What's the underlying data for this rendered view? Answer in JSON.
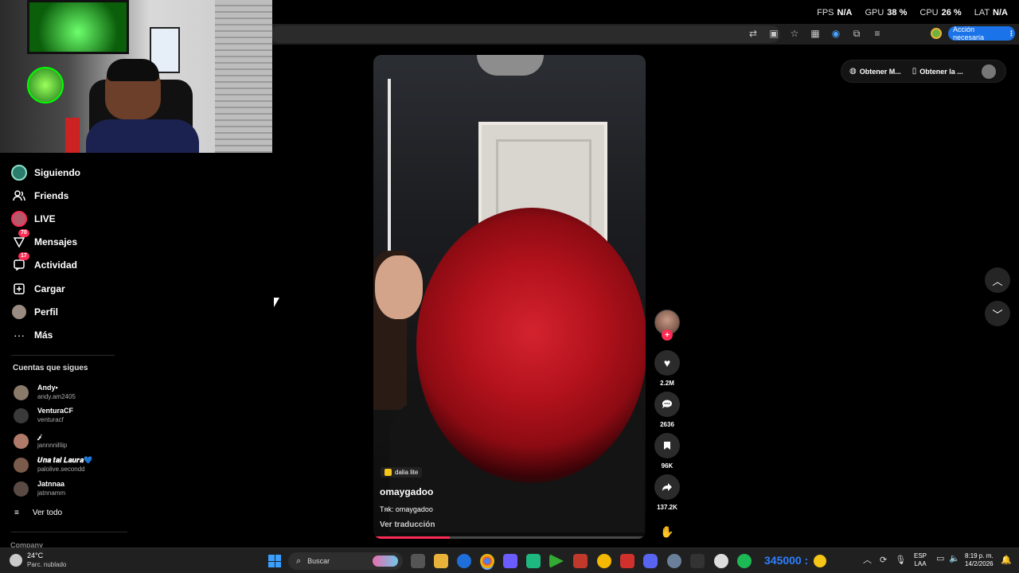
{
  "overlay": {
    "fps_label": "FPS",
    "fps_value": "N/A",
    "gpu_label": "GPU",
    "gpu_value": "38 %",
    "cpu_label": "CPU",
    "cpu_value": "26 %",
    "lat_label": "LAT",
    "lat_value": "N/A"
  },
  "browser": {
    "action_needed": "Acción necesaria",
    "menu_icon": "⋮"
  },
  "sidebar": {
    "items": [
      {
        "label": "Siguiendo",
        "icon": "following-avatar-icon"
      },
      {
        "label": "Friends",
        "icon": "friends-icon"
      },
      {
        "label": "LIVE",
        "icon": "live-icon"
      },
      {
        "label": "Mensajes",
        "icon": "messages-icon",
        "badge": "70"
      },
      {
        "label": "Actividad",
        "icon": "activity-icon",
        "badge": "17"
      },
      {
        "label": "Cargar",
        "icon": "upload-icon"
      },
      {
        "label": "Perfil",
        "icon": "profile-icon"
      },
      {
        "label": "Más",
        "icon": "more-icon"
      }
    ],
    "following_title": "Cuentas que sigues",
    "accounts": [
      {
        "name": "Andy•",
        "handle": "andy.am2405",
        "color": "#8a7a6a"
      },
      {
        "name": "VenturaCF",
        "handle": "venturacf",
        "color": "#3a3a3a"
      },
      {
        "name": "𝒿",
        "handle": "jannnnilliip",
        "color": "#b07a6a"
      },
      {
        "name": "𝑼𝒏𝒂 𝒕𝒂𝒍 𝑳𝒂𝒖𝒓𝒂💙",
        "handle": "palolive.secondd",
        "color": "#7a5a4a"
      },
      {
        "name": "Jatnnaa",
        "handle": "jatnnamm",
        "color": "#5a4a44"
      }
    ],
    "see_all": "Ver todo",
    "company": "Company"
  },
  "video": {
    "effect_label": "dalia lite",
    "author": "omaygadoo",
    "sound": "Tᴙk: omaygadoo",
    "translate": "Ver traducción",
    "progress_percent": 28
  },
  "actions": {
    "likes": "2.2M",
    "comments": "2636",
    "saves": "96K",
    "shares": "137.2K",
    "follow_symbol": "+"
  },
  "top_pill": {
    "get_app_1": "Obtener M...",
    "get_app_2": "Obtener la ..."
  },
  "taskbar": {
    "temp": "24°C",
    "condition": "Parc. nublado",
    "search_placeholder": "Buscar",
    "score": "345000 :",
    "lang_1": "ESP",
    "lang_2": "LAA",
    "time": "8:19 p. m.",
    "date": "14/2/2026"
  }
}
